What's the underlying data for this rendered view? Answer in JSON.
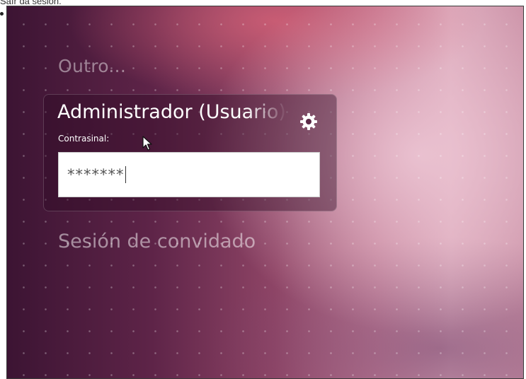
{
  "caption": "Saír da sesión.",
  "login": {
    "other_user": "Outro...",
    "user_name": "Administrador (Usuario)",
    "password_label": "Contrasinal:",
    "password_value": "*******",
    "guest_session": "Sesión de convidado"
  },
  "icons": {
    "session": "gear-icon",
    "pointer": "mouse-cursor-icon"
  },
  "colors": {
    "wallpaper_dark": "#3c1433",
    "wallpaper_mid": "#8f4566",
    "wallpaper_light": "#dba8ba",
    "field_background": "#ffffff"
  }
}
